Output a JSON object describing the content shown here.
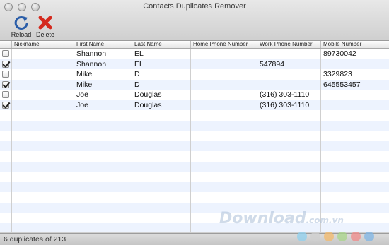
{
  "window": {
    "title": "Contacts Duplicates Remover"
  },
  "toolbar": {
    "reload_label": "Reload",
    "delete_label": "Delete"
  },
  "table": {
    "columns": [
      "",
      "Nickname",
      "First Name",
      "Last Name",
      "Home Phone Number",
      "Work Phone Number",
      "Mobile Number"
    ],
    "rows": [
      {
        "checked": false,
        "nickname": "",
        "first": "Shannon",
        "last": "EL",
        "home": "",
        "work": "",
        "mobile": "89730042"
      },
      {
        "checked": true,
        "nickname": "",
        "first": "Shannon",
        "last": "EL",
        "home": "",
        "work": "547894",
        "mobile": ""
      },
      {
        "checked": false,
        "nickname": "",
        "first": "Mike",
        "last": "D",
        "home": "",
        "work": "",
        "mobile": "3329823"
      },
      {
        "checked": true,
        "nickname": "",
        "first": "Mike",
        "last": "D",
        "home": "",
        "work": "",
        "mobile": "645553457"
      },
      {
        "checked": false,
        "nickname": "",
        "first": "Joe",
        "last": "Douglas",
        "home": "",
        "work": "(316) 303-1110",
        "mobile": ""
      },
      {
        "checked": true,
        "nickname": "",
        "first": "Joe",
        "last": "Douglas",
        "home": "",
        "work": "(316) 303-1110",
        "mobile": ""
      }
    ]
  },
  "status": {
    "text": "6 duplicates of 213"
  },
  "watermark": {
    "text": "Download",
    "domain": ".com.vn"
  },
  "colors": {
    "row_alt": "#edf3fe",
    "reload_icon": "#2a5da8",
    "delete_icon": "#d42a1e",
    "watermark_dots": [
      "#8fd0ef",
      "#cfcfcf",
      "#f3b96b",
      "#a8d68a",
      "#f08a8a",
      "#7fb6e6"
    ]
  }
}
